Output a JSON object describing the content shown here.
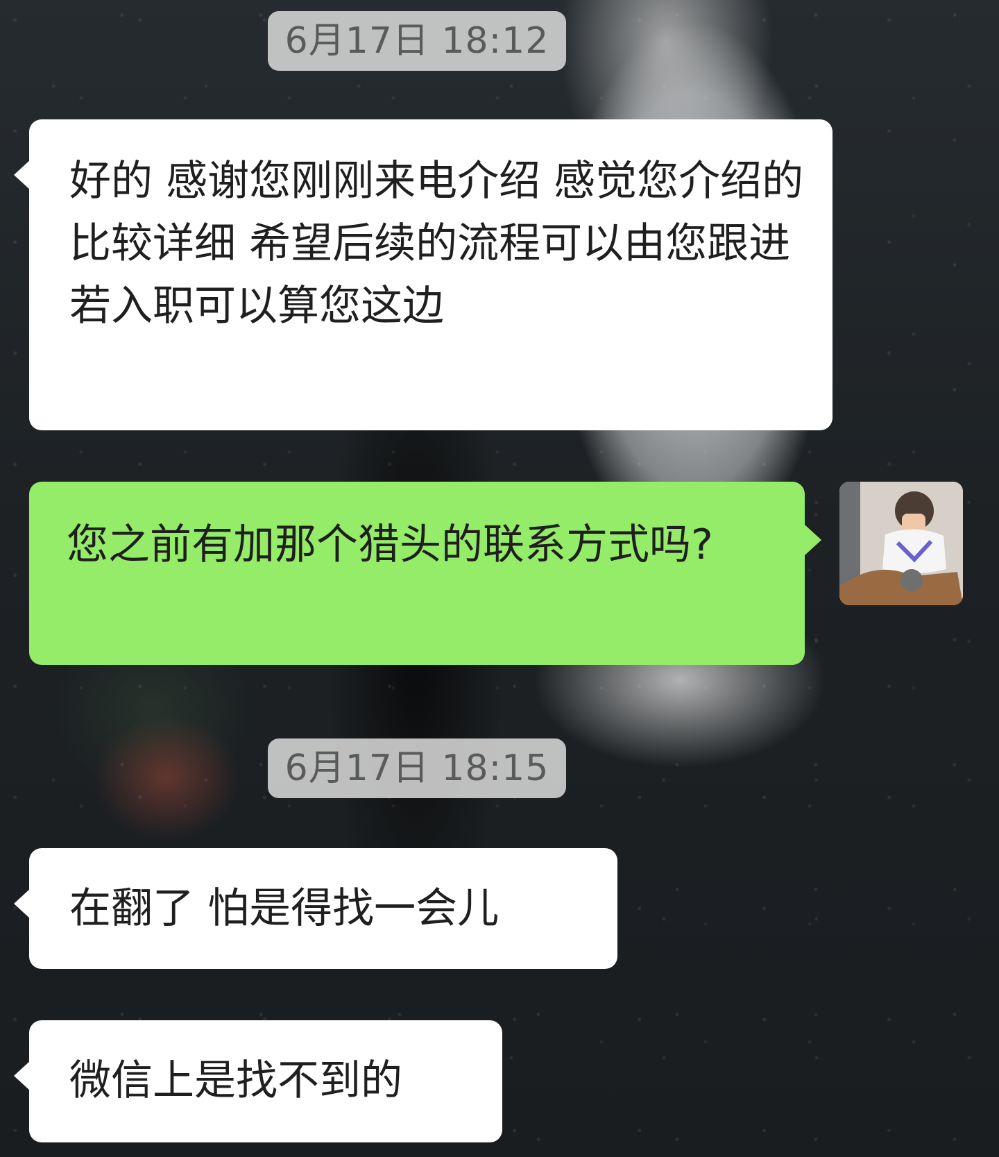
{
  "chat": {
    "timestamps": [
      "6月17日 18:12",
      "6月17日 18:15"
    ],
    "messages": [
      {
        "side": "left",
        "text": "好的 感谢您刚刚来电介绍 感觉您介绍的比较详细 希望后续的流程可以由您跟进 若入职可以算您这边"
      },
      {
        "side": "right",
        "text": "您之前有加那个猎头的联系方式吗?"
      },
      {
        "side": "left",
        "text": "在翻了 怕是得找一会儿"
      },
      {
        "side": "left",
        "text": "微信上是找不到的"
      }
    ]
  },
  "colors": {
    "outgoing_bubble": "#95ec69",
    "incoming_bubble": "#ffffff",
    "timestamp_pill": "#d6d6d6",
    "text": "#1f1f1f"
  }
}
